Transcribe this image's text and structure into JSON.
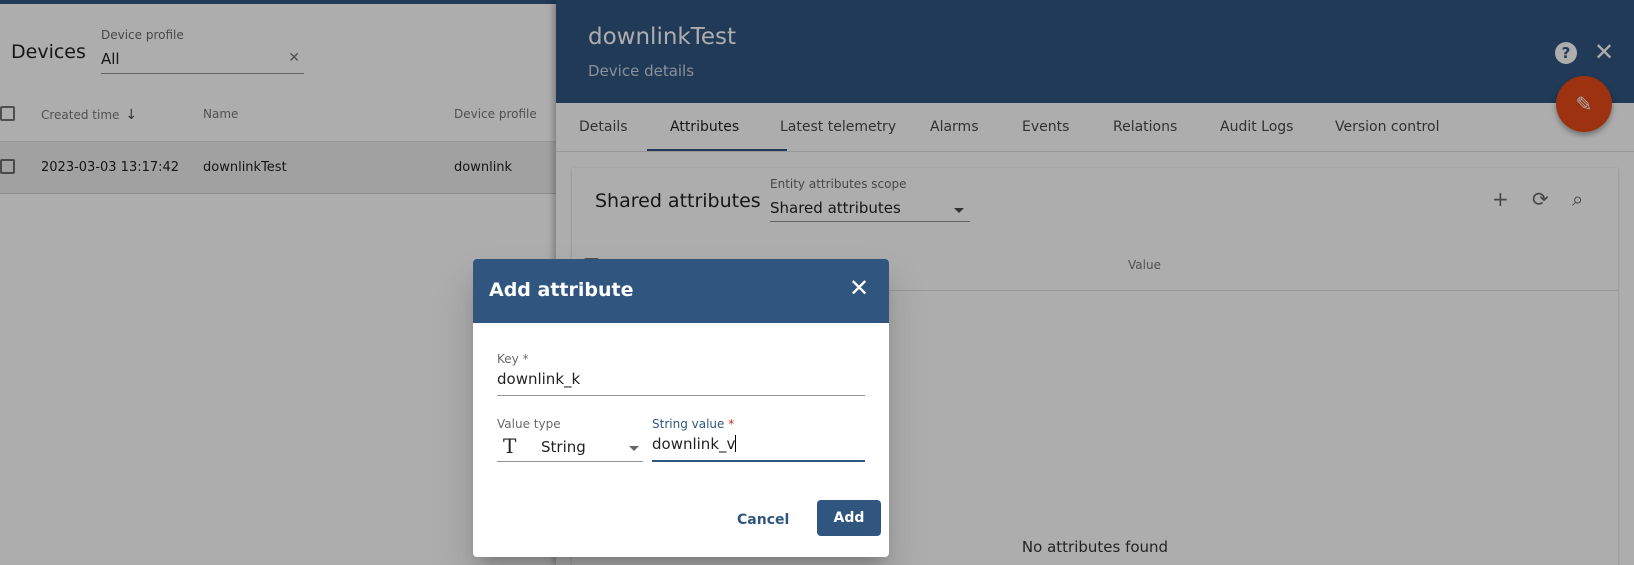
{
  "devices": {
    "title": "Devices",
    "filter": {
      "label": "Device profile",
      "value": "All"
    },
    "columns": {
      "created": "Created time",
      "name": "Name",
      "profile": "Device profile"
    },
    "rows": [
      {
        "created": "2023-03-03 13:17:42",
        "name": "downlinkTest",
        "profile": "downlink"
      }
    ]
  },
  "details": {
    "title": "downlinkTest",
    "subtitle": "Device details",
    "tabs": [
      "Details",
      "Attributes",
      "Latest telemetry",
      "Alarms",
      "Events",
      "Relations",
      "Audit Logs",
      "Version control"
    ],
    "active_tab": "Attributes",
    "attributes": {
      "title": "Shared attributes",
      "scope_label": "Entity attributes scope",
      "scope_value": "Shared attributes",
      "value_column": "Value",
      "empty_text": "No attributes found"
    }
  },
  "dialog": {
    "title": "Add attribute",
    "key": {
      "label": "Key",
      "required": "*",
      "value": "downlink_k"
    },
    "value_type": {
      "label": "Value type",
      "value": "String",
      "icon": "text-type-icon"
    },
    "string_value": {
      "label": "String value",
      "required": "*",
      "value": "downlink_v"
    },
    "cancel": "Cancel",
    "add": "Add"
  },
  "colors": {
    "primary": "#305680",
    "accent": "#e64a19",
    "required": "#c62828"
  }
}
